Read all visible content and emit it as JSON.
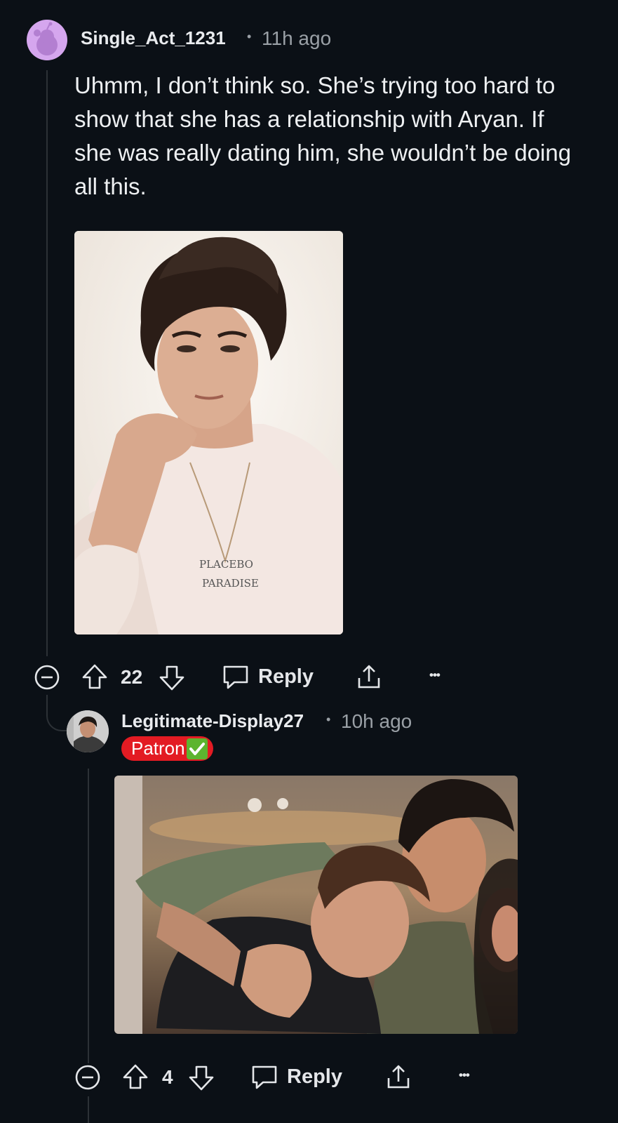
{
  "comments": [
    {
      "username": "Single_Act_1231",
      "time": "11h ago",
      "separator": "•",
      "text": "Uhmm, I don’t think so. She’s trying too hard to show that she has a relationship with Aryan. If she was really dating him, she wouldn’t be doing all this.",
      "image_caption": [
        "PLACEBO",
        "PARADISE"
      ],
      "votes": "22",
      "reply_label": "Reply",
      "more": "•••"
    },
    {
      "username": "Legitimate-Display27",
      "time": "10h ago",
      "separator": "•",
      "flair": "Patron",
      "votes": "4",
      "reply_label": "Reply",
      "more": "•••"
    }
  ],
  "icons": [
    "collapse-icon",
    "upvote-icon",
    "downvote-icon",
    "reply-bubble-icon",
    "share-icon",
    "more-icon",
    "check-mark-icon"
  ],
  "colors": {
    "background": "#0b1016",
    "flair": "#e31b23",
    "check": "#5db42f",
    "avatar_bg": "#d5a6ee"
  }
}
